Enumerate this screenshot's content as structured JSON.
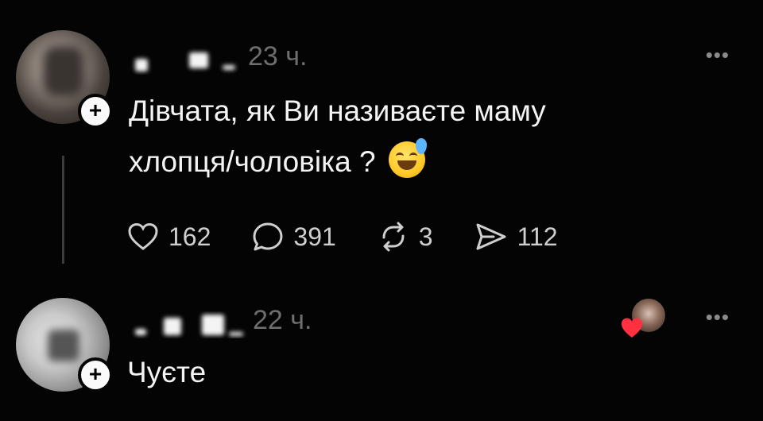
{
  "post": {
    "time": "23 ч.",
    "more": "•••",
    "text_line1": "Дівчата, як Ви називаєте маму",
    "text_line2": "хлопця/чоловіка ?",
    "emoji": "grinning-face-with-sweat",
    "stats": {
      "likes": "162",
      "comments": "391",
      "reposts": "3",
      "shares": "112"
    }
  },
  "reply": {
    "time": "22 ч.",
    "more": "•••",
    "text": "Чуєте"
  },
  "colors": {
    "background": "#040404",
    "text": "#f4f4f4",
    "muted": "#6e6e6e",
    "heart": "#ff3040"
  }
}
